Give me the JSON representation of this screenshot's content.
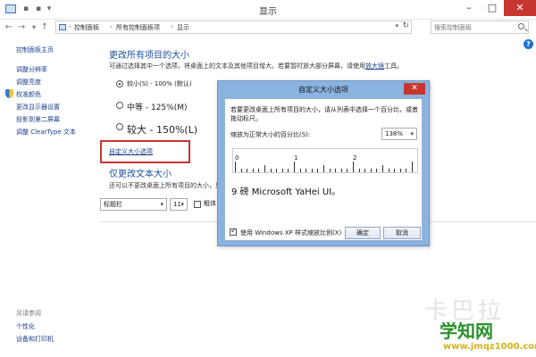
{
  "window": {
    "title": "显示"
  },
  "address": {
    "crumbs": [
      "控制面板",
      "所有控制面板项",
      "显示"
    ],
    "search_placeholder": "搜索控制面板"
  },
  "sidebar": {
    "home": "控制面板主页",
    "links": [
      "调整分辨率",
      "调整亮度",
      "校准颜色",
      "更改显示器设置",
      "投影到第二屏幕",
      "调整 ClearType 文本"
    ],
    "see_also_title": "另请参阅",
    "see_also": [
      "个性化",
      "设备和打印机"
    ]
  },
  "main": {
    "heading": "更改所有项目的大小",
    "desc": "可通过选择其中一个选项，将桌面上的文本及其他项目增大。若要暂时放大部分屏幕，请使用",
    "magnifier_link": "放大镜",
    "desc_tail": "工具。",
    "options": [
      {
        "label": "较小(S) - 100% (默认)",
        "selected": true
      },
      {
        "label": "中等 - 125%(M)",
        "selected": false
      },
      {
        "label": "较大 - 150%(L)",
        "selected": false
      }
    ],
    "custom_link": "自定义大小选项",
    "heading2": "仅更改文本大小",
    "desc2": "还可以不更改桌面上所有项目的大小，只更",
    "element_select": "标题栏",
    "size_select": "11",
    "bold_label": "粗体"
  },
  "dialog": {
    "title": "自定义大小选项",
    "instruction": "若要更改桌面上所有项目的大小，请从列表中选择一个百分比，或者拖动标尺。",
    "percent_label": "缩放为正常大小的百分比(S):",
    "percent_value": "138%",
    "ruler_numbers": [
      "0",
      "1",
      "2"
    ],
    "sample_text": "9 磅 Microsoft YaHei UI。",
    "xp_label": "使用 Windows XP 样式缩放比例(X)",
    "xp_checked": true,
    "ok": "确定",
    "cancel": "取消"
  },
  "watermark": {
    "text": "卡巴拉",
    "logo": "学知网",
    "url": "www.jmqz1000.com"
  }
}
